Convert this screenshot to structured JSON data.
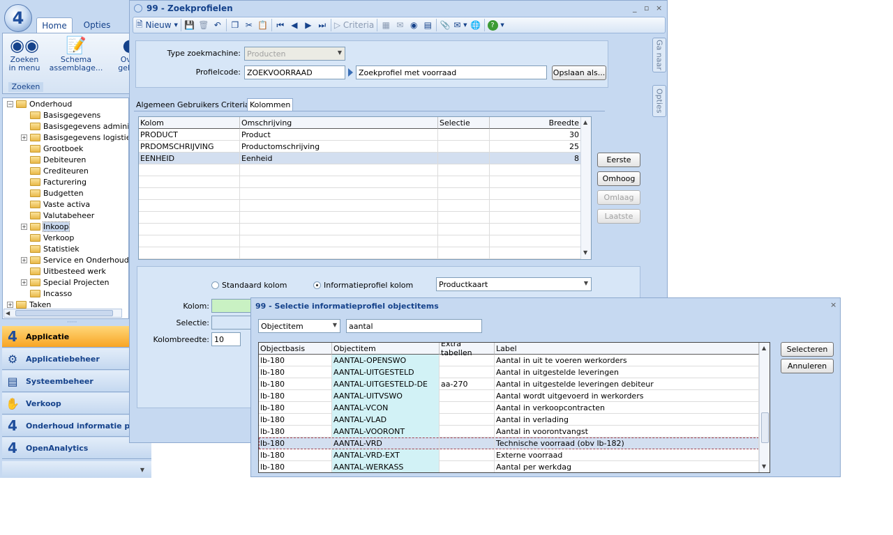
{
  "ribbon": {
    "tabs": [
      "Home",
      "Opties"
    ],
    "buttons": [
      {
        "label1": "Zoeken",
        "label2": "in menu"
      },
      {
        "label1": "Schema",
        "label2": "assemblage..."
      },
      {
        "label1": "Over",
        "label2": "gekop"
      }
    ],
    "group_label": "Zoeken"
  },
  "tree": {
    "root": "Onderhoud",
    "items": [
      {
        "label": "Basisgegevens",
        "expandable": false
      },
      {
        "label": "Basisgegevens administr",
        "expandable": false
      },
      {
        "label": "Basisgegevens logistiek",
        "expandable": true
      },
      {
        "label": "Grootboek",
        "expandable": false
      },
      {
        "label": "Debiteuren",
        "expandable": false
      },
      {
        "label": "Crediteuren",
        "expandable": false
      },
      {
        "label": "Facturering",
        "expandable": false
      },
      {
        "label": "Budgetten",
        "expandable": false
      },
      {
        "label": "Vaste activa",
        "expandable": false
      },
      {
        "label": "Valutabeheer",
        "expandable": false
      },
      {
        "label": "Inkoop",
        "expandable": true
      },
      {
        "label": "Verkoop",
        "expandable": false
      },
      {
        "label": "Statistiek",
        "expandable": false
      },
      {
        "label": "Service en Onderhoud",
        "expandable": true
      },
      {
        "label": "Uitbesteed werk",
        "expandable": false
      },
      {
        "label": "Special Projecten",
        "expandable": true
      },
      {
        "label": "Incasso",
        "expandable": false
      }
    ],
    "last_root": "Taken",
    "selected": "Inkoop"
  },
  "nav": {
    "items": [
      "Applicatie",
      "Applicatiebeheer",
      "Systeembeheer",
      "Verkoop",
      "Onderhoud informatie profi",
      "OpenAnalytics"
    ],
    "active": "Applicatie"
  },
  "win1": {
    "title": "99 - Zoekprofielen",
    "toolbar": {
      "new_label": "Nieuw",
      "criteria_label": "Criteria"
    },
    "type_label": "Type zoekmachine:",
    "type_value": "Producten",
    "profile_label": "Profielcode:",
    "profile_code": "ZOEKVOORRAAD",
    "profile_desc": "Zoekprofiel met voorraad",
    "save_as": "Opslaan als...",
    "tabs": [
      "Algemeen",
      "Gebruikers",
      "Criteria",
      "Kolommen"
    ],
    "active_tab": "Kolommen",
    "grid_headers": [
      "Kolom",
      "Omschrijving",
      "Selectie",
      "Breedte"
    ],
    "grid_rows": [
      {
        "kolom": "PRODUCT",
        "omschrijving": "Product",
        "selectie": "",
        "breedte": "30"
      },
      {
        "kolom": "PRDOMSCHRIJVING",
        "omschrijving": " Productomschrijving",
        "selectie": "",
        "breedte": "25"
      },
      {
        "kolom": "EENHEID",
        "omschrijving": "Eenheid",
        "selectie": "",
        "breedte": "8"
      }
    ],
    "side_buttons": [
      "Eerste",
      "Omhoog",
      "Omlaag",
      "Laatste"
    ],
    "radio_standard": "Standaard kolom",
    "radio_info": "Informatieprofiel kolom",
    "info_combo": "Productkaart",
    "kolom_label": "Kolom:",
    "selectie_label": "Selectie:",
    "breedte_label": "Kolombreedte:",
    "breedte_value": "10",
    "side_tabs": [
      "Ga naar",
      "Opties"
    ]
  },
  "win2": {
    "title": "99 - Selectie informatieprofiel objectitems",
    "filter_type": "Objectitem",
    "search_value": "aantal",
    "headers": [
      "Objectbasis",
      "Objectitem",
      "Extra tabellen",
      "Label"
    ],
    "rows": [
      {
        "basis": "lb-180",
        "item": "AANTAL-OPENSWO",
        "extra": "",
        "label": "Aantal in uit te voeren werkorders"
      },
      {
        "basis": "lb-180",
        "item": "AANTAL-UITGESTELD",
        "extra": "",
        "label": "Aantal in uitgestelde leveringen"
      },
      {
        "basis": "lb-180",
        "item": "AANTAL-UITGESTELD-DE",
        "extra": "aa-270",
        "label": "Aantal in uitgestelde leveringen debiteur"
      },
      {
        "basis": "lb-180",
        "item": "AANTAL-UITVSWO",
        "extra": "",
        "label": "Aantal wordt uitgevoerd in werkorders"
      },
      {
        "basis": "lb-180",
        "item": "AANTAL-VCON",
        "extra": "",
        "label": "Aantal in verkoopcontracten"
      },
      {
        "basis": "lb-180",
        "item": "AANTAL-VLAD",
        "extra": "",
        "label": "Aantal in verlading"
      },
      {
        "basis": "lb-180",
        "item": "AANTAL-VOORONT",
        "extra": "",
        "label": "Aantal in voorontvangst"
      },
      {
        "basis": "lb-180",
        "item": "AANTAL-VRD",
        "extra": "",
        "label": "Technische voorraad (obv lb-182)"
      },
      {
        "basis": "lb-180",
        "item": "AANTAL-VRD-EXT",
        "extra": "",
        "label": "Externe voorraad"
      },
      {
        "basis": "lb-180",
        "item": "AANTAL-WERKASS",
        "extra": "",
        "label": "Aantal per werkdag"
      }
    ],
    "selected_item": "AANTAL-VRD",
    "select_button": "Selecteren",
    "cancel_button": "Annuleren"
  }
}
